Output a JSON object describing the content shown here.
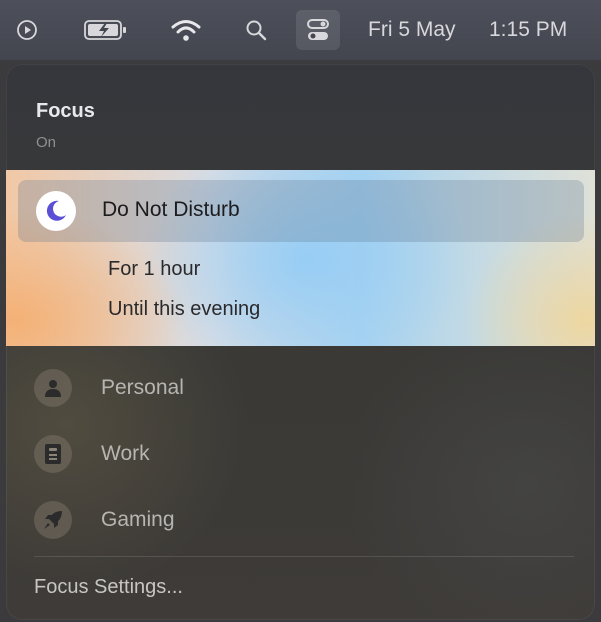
{
  "menubar": {
    "items": [
      {
        "icon": "play-circle-icon"
      },
      {
        "icon": "battery-charging-icon"
      },
      {
        "icon": "wifi-icon"
      },
      {
        "icon": "search-icon"
      },
      {
        "icon": "control-center-icon"
      }
    ],
    "date": "Fri 5 May",
    "time": "1:15 PM"
  },
  "focus": {
    "title": "Focus",
    "status": "On",
    "active_mode": {
      "label": "Do Not Disturb",
      "icon": "moon-icon",
      "icon_color": "#5b4fd6",
      "options": [
        "For 1 hour",
        "Until this evening"
      ]
    },
    "modes": [
      {
        "label": "Personal",
        "icon": "person-icon"
      },
      {
        "label": "Work",
        "icon": "id-badge-icon"
      },
      {
        "label": "Gaming",
        "icon": "rocket-icon"
      }
    ],
    "settings_label": "Focus Settings..."
  }
}
